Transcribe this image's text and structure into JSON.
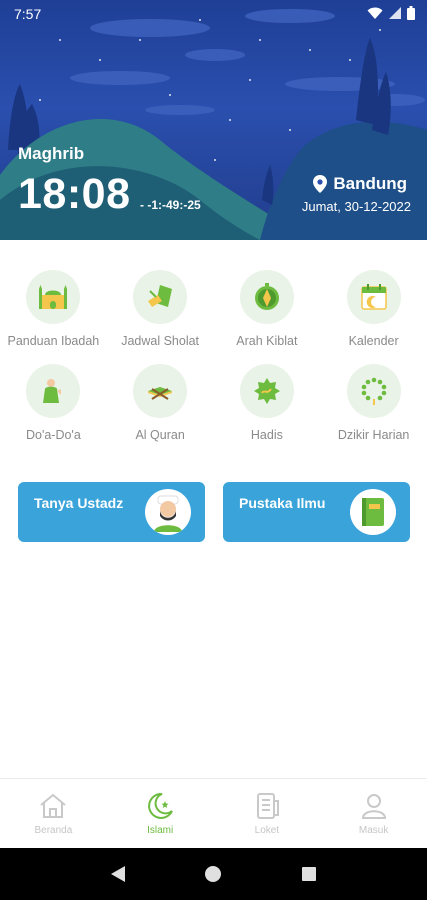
{
  "status_bar": {
    "time": "7:57",
    "icons": [
      "wifi-icon",
      "signal-icon",
      "battery-icon"
    ]
  },
  "header": {
    "prayer_name": "Maghrib",
    "prayer_time": "18:08",
    "countdown": "- -1:-49:-25",
    "city": "Bandung",
    "date": "Jumat, 30-12-2022"
  },
  "menu": [
    {
      "label": "Panduan Ibadah",
      "icon": "mosque-icon"
    },
    {
      "label": "Jadwal Sholat",
      "icon": "prayer-schedule-icon"
    },
    {
      "label": "Arah Kiblat",
      "icon": "compass-icon"
    },
    {
      "label": "Kalender",
      "icon": "calendar-icon"
    },
    {
      "label": "Do'a-Do'a",
      "icon": "praying-person-icon"
    },
    {
      "label": "Al Quran",
      "icon": "quran-icon"
    },
    {
      "label": "Hadis",
      "icon": "hadith-icon"
    },
    {
      "label": "Dzikir Harian",
      "icon": "prayer-beads-icon"
    }
  ],
  "cards": {
    "tanya": {
      "label": "Tanya Ustadz",
      "icon": "ustadz-avatar-icon"
    },
    "pustaka": {
      "label": "Pustaka Ilmu",
      "icon": "book-icon"
    }
  },
  "bottom_nav": [
    {
      "label": "Beranda",
      "icon": "home-icon",
      "active": false
    },
    {
      "label": "Islami",
      "icon": "crescent-icon",
      "active": true
    },
    {
      "label": "Loket",
      "icon": "receipt-icon",
      "active": false
    },
    {
      "label": "Masuk",
      "icon": "user-icon",
      "active": false
    }
  ],
  "colors": {
    "header": "#2a4fae",
    "accent_green": "#6dbb3f",
    "card_blue": "#3aa3d9",
    "icon_bg": "#e9f3e7"
  }
}
